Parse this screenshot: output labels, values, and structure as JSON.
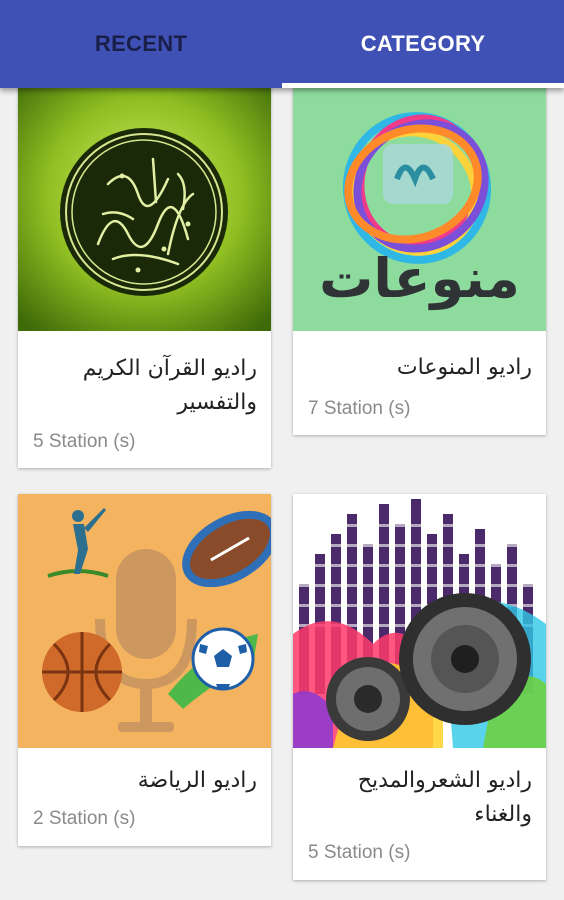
{
  "tabs": [
    {
      "label": "RECENT",
      "selected": false
    },
    {
      "label": "CATEGORY",
      "selected": true
    }
  ],
  "colors": {
    "tabbar": "#3f51b5",
    "tab_inactive": "#1a1f4a",
    "tab_active": "#ffffff"
  },
  "cards": [
    {
      "title": "راديو القرآن الكريم والتفسير",
      "count": "5 Station (s)",
      "image": "quran-calligraphy-image"
    },
    {
      "title": "راديو المنوعات",
      "count": "7 Station (s)",
      "image": "variety-logo-image",
      "image_text": "منوعات"
    },
    {
      "title": "راديو الرياضة",
      "count": "2 Station (s)",
      "image": "sports-microphone-image"
    },
    {
      "title": "راديو الشعروالمديح والغناء",
      "count": "5 Station (s)",
      "image": "speakers-equalizer-image"
    }
  ]
}
